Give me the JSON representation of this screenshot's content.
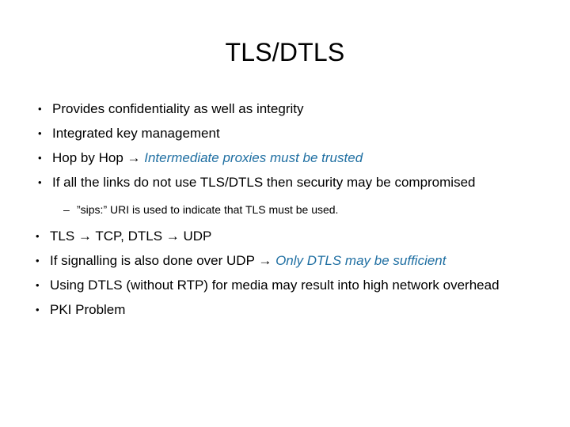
{
  "slide": {
    "title": "TLS/DTLS",
    "accent_color": "#1f6fa2",
    "text_color": "#000000",
    "background_color": "#ffffff",
    "bullet_glyph": "•",
    "dash_glyph": "–",
    "arrow_glyph": "→",
    "upper_bullets": [
      {
        "text": "Provides confidentiality as well as integrity",
        "accent": "",
        "arrow": false
      },
      {
        "text": "Integrated key management",
        "accent": "",
        "arrow": false
      },
      {
        "text": "Hop by Hop ",
        "accent": "Intermediate proxies must be trusted",
        "arrow": true
      },
      {
        "text": "If all the links do not use TLS/DTLS then security may be compromised",
        "accent": "",
        "arrow": false
      }
    ],
    "sub_bullets": [
      {
        "text": "”sips:” URI is used to indicate that TLS must be used."
      }
    ],
    "lower_bullets": [
      {
        "text_before": "TLS ",
        "text_middle": " TCP, DTLS ",
        "text_after": " UDP",
        "accent": "",
        "double_arrow": true
      },
      {
        "text": "If signalling is also done over UDP ",
        "accent": "Only DTLS may be sufficient",
        "arrow": true
      },
      {
        "text": "Using DTLS (without RTP) for media may result into high network overhead",
        "accent": "",
        "arrow": false
      },
      {
        "text": "PKI Problem",
        "accent": "",
        "arrow": false
      }
    ]
  }
}
